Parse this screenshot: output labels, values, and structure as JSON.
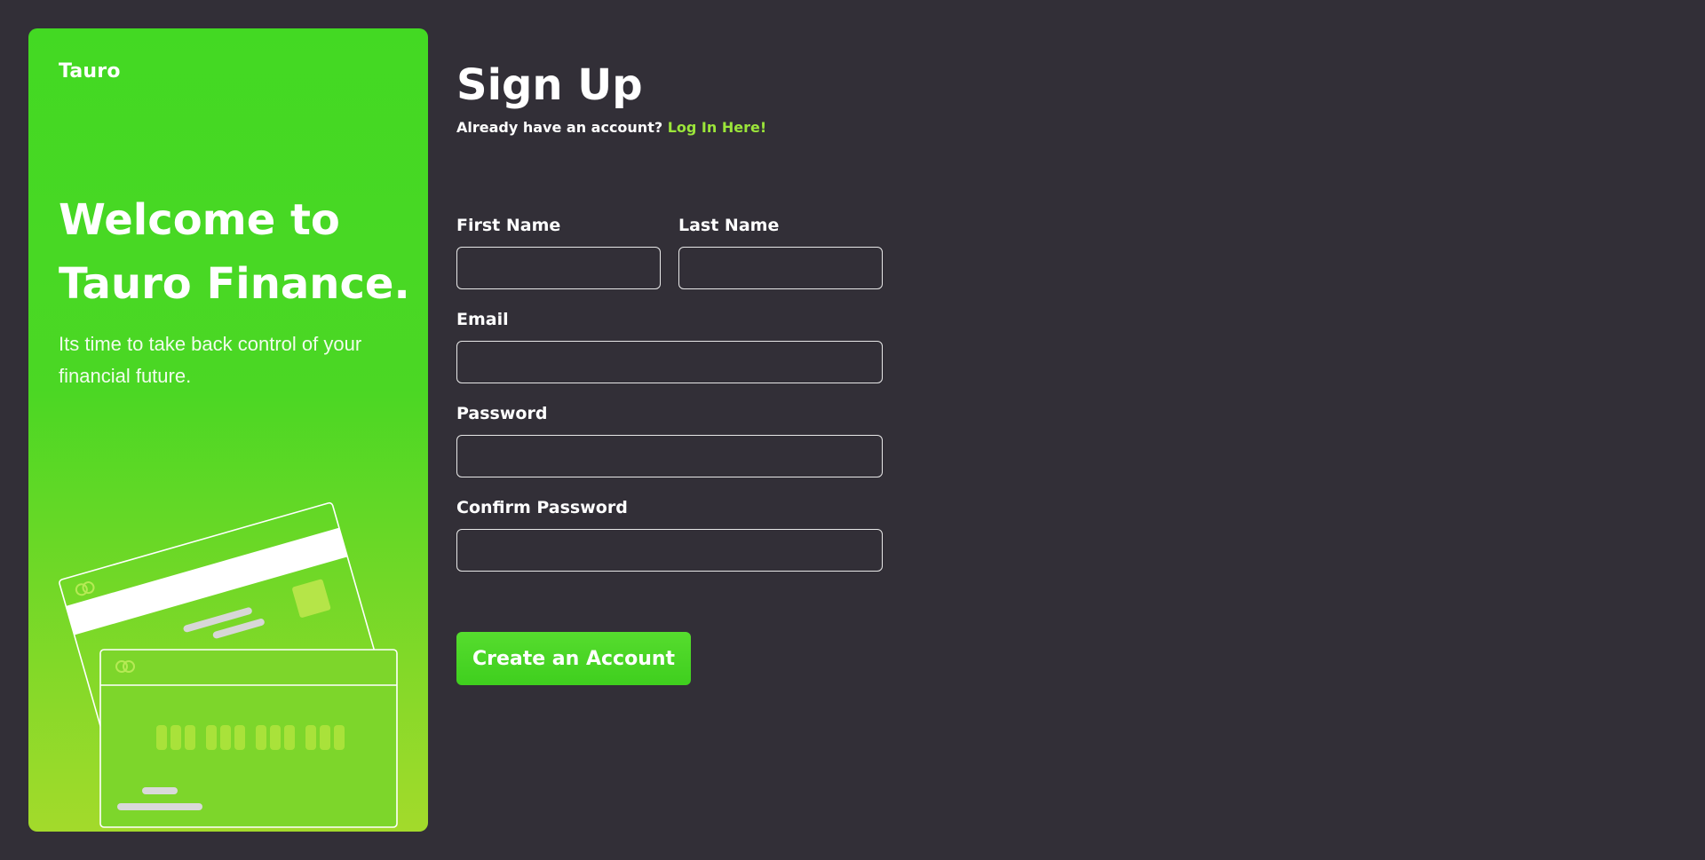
{
  "brand": "Tauro",
  "promo": {
    "welcome_line1": "Welcome to",
    "welcome_line2": "Tauro Finance.",
    "tagline": "Its time to take back control of your financial future."
  },
  "form": {
    "title": "Sign Up",
    "subtitle_prefix": "Already have an account? ",
    "login_link": "Log In Here!",
    "first_name_label": "First Name",
    "first_name_value": "",
    "last_name_label": "Last Name",
    "last_name_value": "",
    "email_label": "Email",
    "email_value": "",
    "password_label": "Password",
    "password_value": "",
    "confirm_password_label": "Confirm Password",
    "confirm_password_value": "",
    "submit_label": "Create an Account"
  },
  "colors": {
    "background": "#322f37",
    "panel_top": "#43d923",
    "panel_bottom": "#a3da2b",
    "link": "#9be53a",
    "button": "#4ad626"
  },
  "icons": [
    "credit-card-illustration"
  ]
}
